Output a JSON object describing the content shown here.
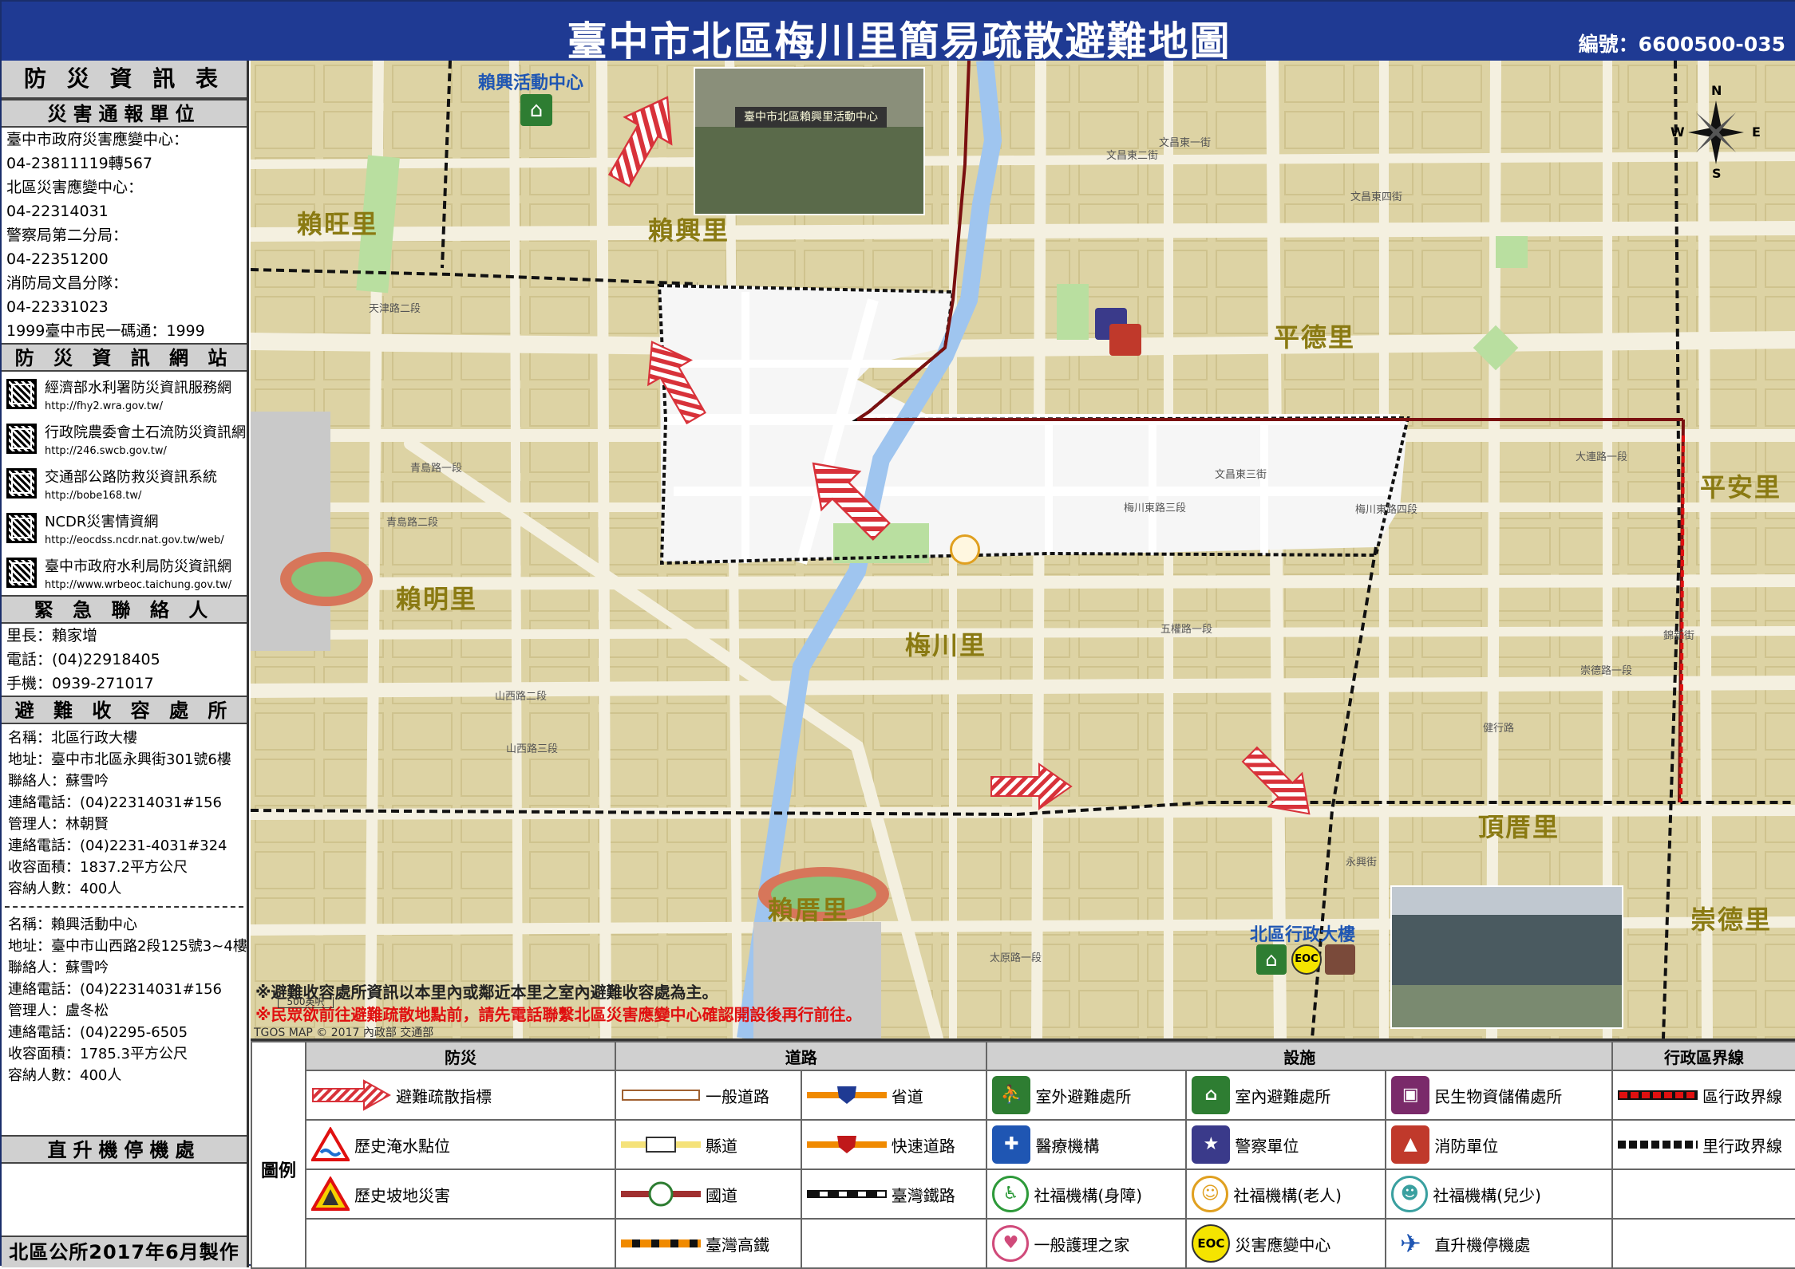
{
  "header": {
    "title": "臺中市北區梅川里簡易疏散避難地圖",
    "code": "編號：6600500-035"
  },
  "side": {
    "title": "防 災 資 訊 表",
    "report_title": "災害通報單位",
    "report_lines": [
      "臺中市政府災害應變中心：",
      "04-23811119轉567",
      "北區災害應變中心：",
      "04-22314031",
      "警察局第二分局：",
      "04-22351200",
      "消防局文昌分隊：",
      "04-22331023",
      "1999臺中市民一碼通：1999"
    ],
    "web_title": "防 災 資 訊 網 站",
    "websites": [
      {
        "name": "經濟部水利署防災資訊服務網",
        "url": "http://fhy2.wra.gov.tw/"
      },
      {
        "name": "行政院農委會土石流防災資訊網",
        "url": "http://246.swcb.gov.tw/"
      },
      {
        "name": "交通部公路防救災資訊系統",
        "url": "http://bobe168.tw/"
      },
      {
        "name": "NCDR災害情資網",
        "url": "http://eocdss.ncdr.nat.gov.tw/web/"
      },
      {
        "name": "臺中市政府水利局防災資訊網",
        "url": "http://www.wrbeoc.taichung.gov.tw/"
      }
    ],
    "contact_title": "緊 急 聯 絡 人",
    "contact_lines": [
      "里長：賴家增",
      "電話：(04)22918405",
      "手機：0939-271017"
    ],
    "shelter_title": "避 難 收 容 處 所",
    "shelter1": [
      "名稱：北區行政大樓",
      "地址：臺中市北區永興街301號6樓",
      "聯絡人：蘇雪吟",
      "連絡電話：(04)22314031#156",
      "管理人：林朝賢",
      "連絡電話：(04)2231-4031#324",
      "收容面積：1837.2平方公尺",
      "容納人數：400人"
    ],
    "shelter2": [
      "名稱：賴興活動中心",
      "地址：臺中市山西路2段125號3~4樓",
      "聯絡人：蘇雪吟",
      "連絡電話：(04)22314031#156",
      "管理人：盧冬松",
      "連絡電話：(04)2295-6505",
      "收容面積：1785.3平方公尺",
      "容納人數：400人"
    ],
    "heli_title": "直升機停機處",
    "footer": "北區公所2017年6月製作"
  },
  "map": {
    "villages": {
      "laiwang": "賴旺里",
      "laixing": "賴興里",
      "pingde": "平德里",
      "pingan": "平安里",
      "laiming": "賴明里",
      "meichuan": "梅川里",
      "laicuo": "賴厝里",
      "dingcuo": "頂厝里",
      "chongde": "崇德里"
    },
    "facilities": {
      "laixing_center": "賴興活動中心",
      "north_admin": "北區行政大樓"
    },
    "photo_sign": "臺中市北區賴興里活動中心",
    "note1": "※避難收容處所資訊以本里內或鄰近本里之室內避難收容處為主。",
    "note2": "※民眾欲前往避難疏散地點前，請先電話聯繫北區災害應變中心確認開設後再行前往。",
    "copyright": "TGOS MAP © 2017 內政部 交通部",
    "scale": "500英呎",
    "compass": {
      "n": "N",
      "s": "S",
      "e": "E",
      "w": "W"
    },
    "roads": [
      "文昌東一街",
      "文昌東二街",
      "文昌東三街",
      "文昌東四街",
      "青島路一段",
      "青島路二段",
      "梅川東路三段",
      "梅川東路四段",
      "五權路一段",
      "大連路一段",
      "太原路一段",
      "永興街",
      "山西路二段",
      "山西路三段",
      "崇德路一段",
      "天津路二段",
      "錦新街",
      "健行路"
    ]
  },
  "legend": {
    "label": "圖例",
    "headers": {
      "disaster": "防災",
      "roads": "道路",
      "facilities": "設施",
      "boundary": "行政區界線"
    },
    "disaster": [
      "避難疏散指標",
      "歷史淹水點位",
      "歷史坡地災害"
    ],
    "roads": [
      "一般道路",
      "省道",
      "縣道",
      "快速道路",
      "國道",
      "臺灣鐵路",
      "臺灣高鐵"
    ],
    "facilities": [
      "室外避難處所",
      "室內避難處所",
      "民生物資儲備處所",
      "醫療機構",
      "警察單位",
      "消防單位",
      "社福機構(身障)",
      "社福機構(老人)",
      "社福機構(兒少)",
      "一般護理之家",
      "災害應變中心",
      "直升機停機處"
    ],
    "boundary": [
      "區行政界線",
      "里行政界線"
    ],
    "eoc": "EOC"
  },
  "colors": {
    "header": "#1f3a93",
    "map_base": "#ddd3a4",
    "road": "#f4f0e0",
    "arrow": "#d8323a",
    "district_line": "#7a1010",
    "village_line": "#111111"
  }
}
